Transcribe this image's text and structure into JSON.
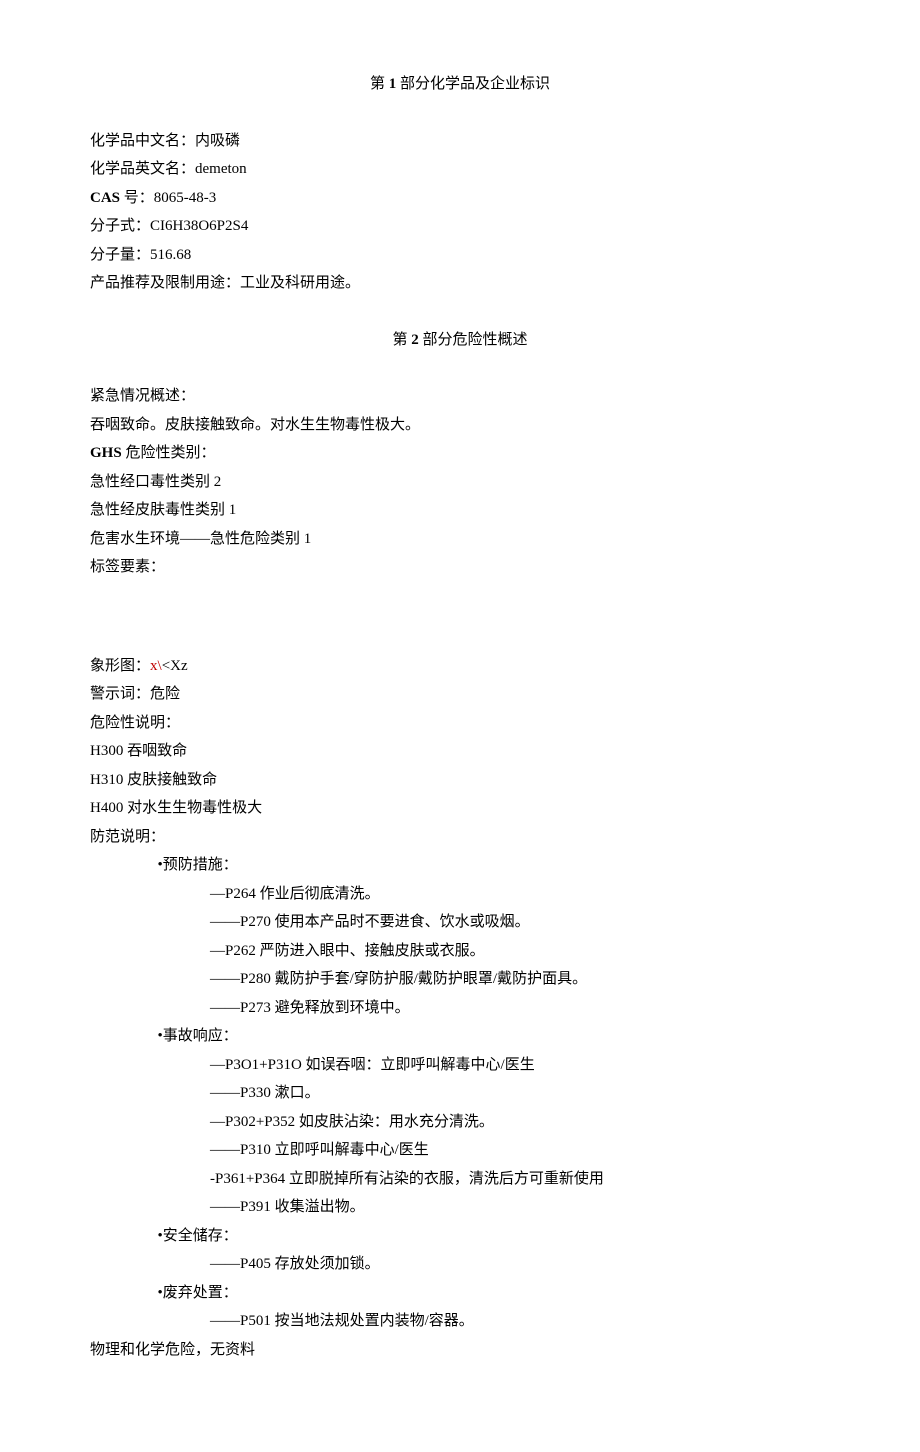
{
  "section1": {
    "title_prefix": "第 ",
    "title_num": "1",
    "title_suffix": " 部分化学品及企业标识",
    "lines": {
      "name_cn_label": "化学品中文名：",
      "name_cn": "内吸磷",
      "name_en_label": "化学品英文名：",
      "name_en": "demeton",
      "cas_label": "CAS",
      "cas_suffix": " 号：",
      "cas": "8065-48-3",
      "formula_label": "分子式：",
      "formula": "CI6H38O6P2S4",
      "mw_label": "分子量：",
      "mw": "516.68",
      "usage_label": "产品推荐及限制用途：",
      "usage": "工业及科研用途。"
    }
  },
  "section2": {
    "title_prefix": "第 ",
    "title_num": "2",
    "title_suffix": " 部分危险性概述",
    "emergency_label": "紧急情况概述：",
    "emergency_text": "吞咽致命。皮肤接触致命。对水生生物毒性极大。",
    "ghs_label_bold": "GHS",
    "ghs_label_suffix": " 危险性类别：",
    "ghs_categories": [
      "急性经口毒性类别 2",
      "急性经皮肤毒性类别 1",
      "危害水生环境——急性危险类别 1"
    ],
    "label_elements": "标签要素：",
    "pictogram_label": "象形图：",
    "pictogram_red": "x\\",
    "pictogram_rest": "<Xz",
    "signal_label": "警示词：",
    "signal": "危险",
    "hazard_label": "危险性说明：",
    "hazard_statements": [
      "H300 吞咽致命",
      "H310 皮肤接触致命",
      "H400 对水生生物毒性极大"
    ],
    "precaution_label": "防范说明：",
    "prevention_header": "•预防措施：",
    "prevention_items": [
      "—P264 作业后彻底清洗。",
      "——P270 使用本产品时不要进食、饮水或吸烟。",
      "—P262 严防进入眼中、接触皮肤或衣服。",
      "——P280 戴防护手套/穿防护服/戴防护眼罩/戴防护面具。",
      "——P273 避免释放到环境中。"
    ],
    "response_header": "•事故响应：",
    "response_items": [
      "—P3O1+P31O 如误吞咽：立即呼叫解毒中心/医生",
      "——P330 漱口。",
      "—P302+P352 如皮肤沾染：用水充分清洗。",
      "——P310 立即呼叫解毒中心/医生",
      "-P361+P364 立即脱掉所有沾染的衣服，清洗后方可重新使用",
      "——P391 收集溢出物。"
    ],
    "storage_header": "•安全储存：",
    "storage_items": [
      "——P405 存放处须加锁。"
    ],
    "disposal_header": "•废弃处置：",
    "disposal_items": [
      "——P501 按当地法规处置内装物/容器。"
    ],
    "physchem": "物理和化学危险，无资料"
  }
}
